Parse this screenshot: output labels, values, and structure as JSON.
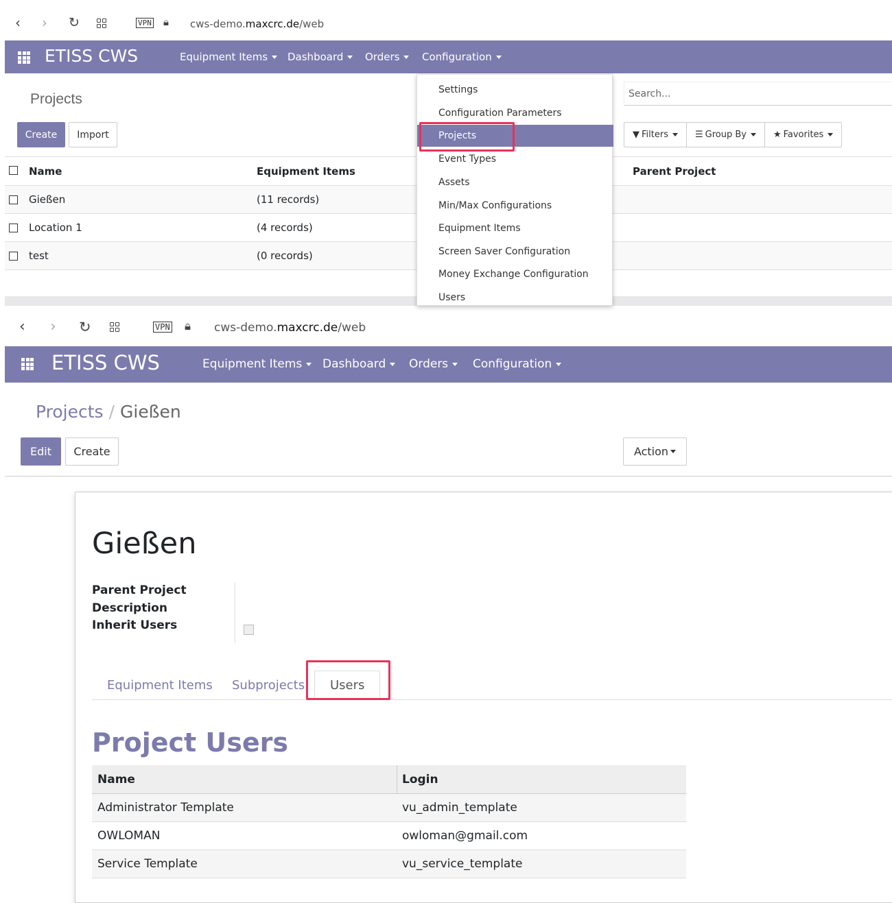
{
  "top": {
    "browser": {
      "vpn": "VPN",
      "url_pre": "cws-demo.",
      "url_host": "maxcrc.de",
      "url_post": "/web"
    },
    "nav": {
      "brand": "ETISS CWS",
      "menus": [
        "Equipment Items",
        "Dashboard",
        "Orders",
        "Configuration"
      ]
    },
    "title": "Projects",
    "buttons": {
      "create": "Create",
      "import": "Import"
    },
    "search_placeholder": "Search...",
    "filters": {
      "filters": "Filters",
      "group_by": "Group By",
      "favorites": "Favorites"
    },
    "columns": {
      "name": "Name",
      "equipment": "Equipment Items",
      "parent": "Parent Project"
    },
    "rows": [
      {
        "name": "Gießen",
        "equipment": "(11 records)"
      },
      {
        "name": "Location 1",
        "equipment": "(4 records)"
      },
      {
        "name": "test",
        "equipment": "(0 records)"
      }
    ],
    "dropdown": [
      "Settings",
      "Configuration Parameters",
      "Projects",
      "Event Types",
      "Assets",
      "Min/Max Configurations",
      "Equipment Items",
      "Screen Saver Configuration",
      "Money Exchange Configuration",
      "Users"
    ]
  },
  "bottom": {
    "browser": {
      "vpn": "VPN",
      "url_pre": "cws-demo.",
      "url_host": "maxcrc.de",
      "url_post": "/web"
    },
    "nav": {
      "brand": "ETISS CWS",
      "menus": [
        "Equipment Items",
        "Dashboard",
        "Orders",
        "Configuration"
      ]
    },
    "breadcrumb": {
      "parent": "Projects",
      "sep": "/",
      "current": "Gießen"
    },
    "buttons": {
      "edit": "Edit",
      "create": "Create",
      "action": "Action"
    },
    "form": {
      "title": "Gießen",
      "labels": {
        "parent": "Parent Project",
        "description": "Description",
        "inherit": "Inherit Users"
      },
      "tabs": [
        "Equipment Items",
        "Subprojects",
        "Users"
      ],
      "section": "Project Users",
      "columns": {
        "name": "Name",
        "login": "Login"
      },
      "users": [
        {
          "name": "Administrator Template",
          "login": "vu_admin_template"
        },
        {
          "name": "OWLOMAN",
          "login": "owloman@gmail.com"
        },
        {
          "name": "Service Template",
          "login": "vu_service_template"
        }
      ]
    }
  },
  "colors": {
    "brand": "#7c7bad",
    "highlight": "#e8325a"
  }
}
